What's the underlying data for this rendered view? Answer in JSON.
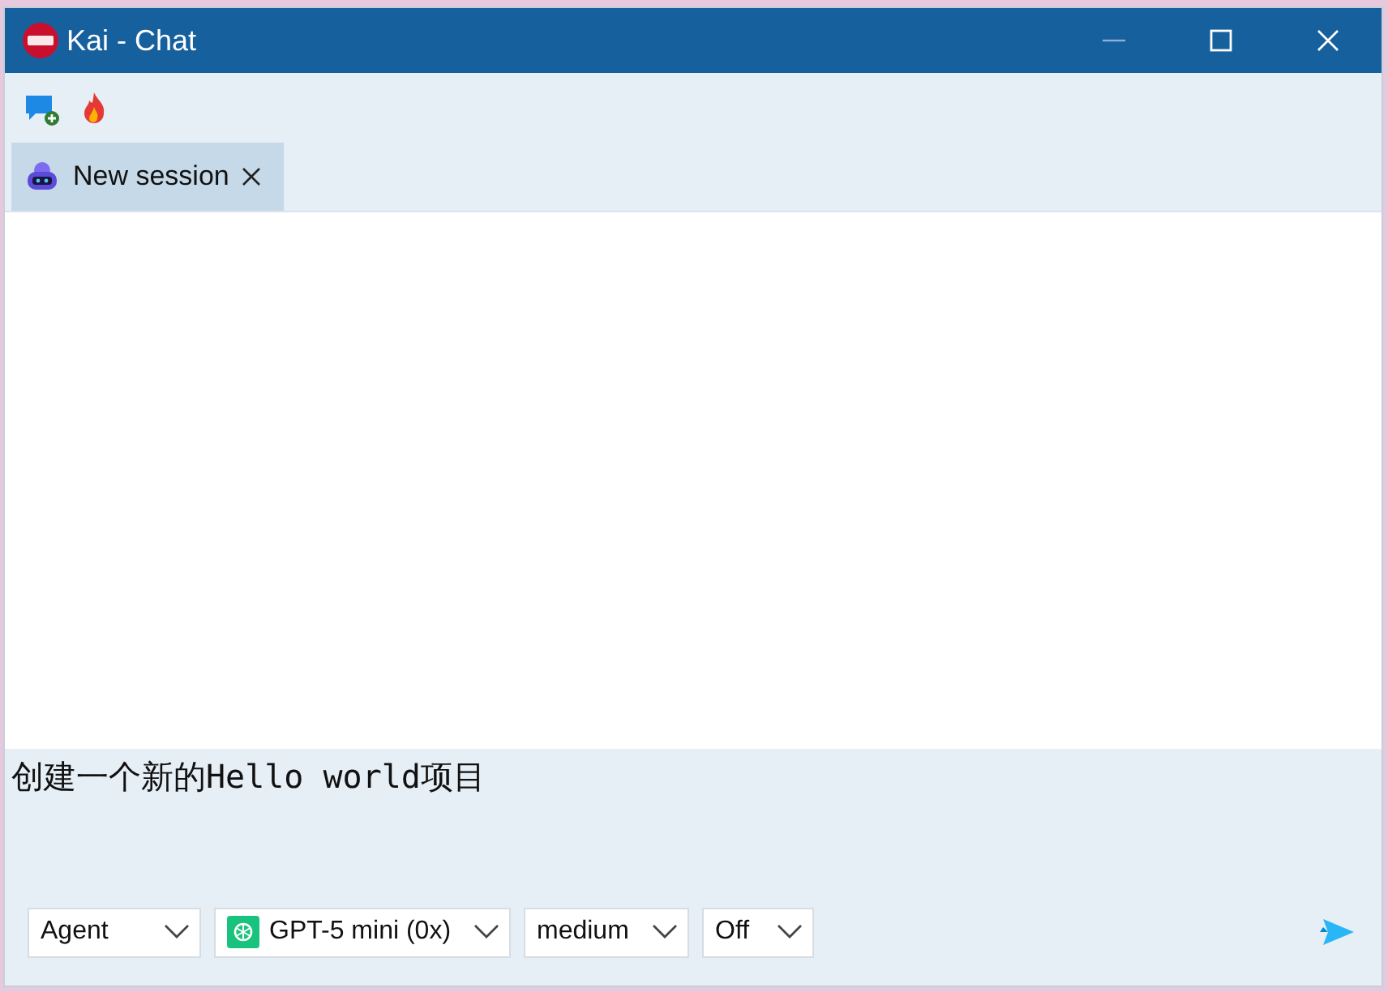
{
  "window": {
    "title": "Kai - Chat"
  },
  "tabs": [
    {
      "label": "New session",
      "selected": true
    }
  ],
  "input": {
    "value": "创建一个新的Hello world项目"
  },
  "dropdowns": [
    {
      "kind": "plain",
      "value": "Agent"
    },
    {
      "kind": "model",
      "value": "GPT-5 mini (0x)"
    },
    {
      "kind": "plain",
      "value": "medium"
    },
    {
      "kind": "plain",
      "value": "Off"
    }
  ]
}
